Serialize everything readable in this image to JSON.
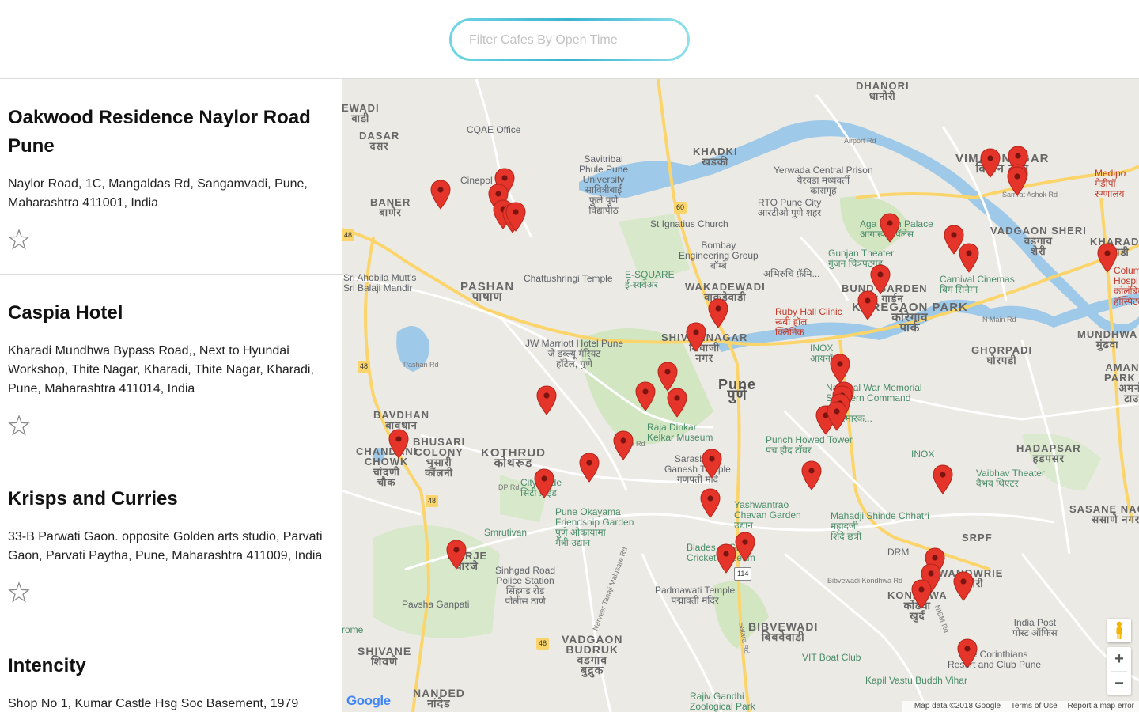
{
  "search": {
    "placeholder": "Filter Cafes By Open Time"
  },
  "cafes": [
    {
      "name": "Oakwood Residence Naylor Road Pune",
      "address": "Naylor Road, 1C, Mangaldas Rd, Sangamvadi, Pune, Maharashtra 411001, India"
    },
    {
      "name": "Caspia Hotel",
      "address": "Kharadi Mundhwa Bypass Road,, Next to Hyundai Workshop, Thite Nagar, Kharadi, Thite Nagar, Kharadi, Pune, Maharashtra 411014, India"
    },
    {
      "name": "Krisps and Curries",
      "address": "33-B Parwati Gaon. opposite Golden arts studio, Parvati Gaon, Parvati Paytha, Pune, Maharashtra 411009, India"
    },
    {
      "name": "Intencity",
      "address": "Shop No 1, Kumar Castle Hsg Soc Basement, 1979"
    }
  ],
  "map": {
    "labels": {
      "dhanori": "DHANORI",
      "dhanori_mr": "धानोरी",
      "ewadi": "EWADI",
      "ewadi_mr": "वाडी",
      "cqae": "CQAE Office",
      "dasar": "DASAR",
      "dasar_mr": "दसर",
      "khadki": "KHADKI",
      "khadki_mr": "खडकी",
      "savitribai": "Savitribai",
      "savitribai2": "Phule Pune",
      "savitribai3": "University",
      "savitribai_mr": "सावित्रीबाई",
      "savitribai_mr2": "फुले पुणे",
      "savitribai_mr3": "विद्यापीठ",
      "yerwada": "Yerwada Central Prison",
      "yerwada_mr": "येरवडा मध्यवर्ती",
      "yerwada_mr2": "कारागृह",
      "viman": "VIMAN NAGAR",
      "viman_mr": "विमान नगर",
      "medipoint": "Medipo",
      "medipoint_mr": "मेडीपॉ",
      "medipoint_mr2": "रुग्णालय",
      "airport_rd": "Airport Rd",
      "baner": "BANER",
      "baner_mr": "बाणेर",
      "cinepolis": "Cinepol",
      "rto": "RTO Pune City",
      "rto_mr": "आरटीओ पुणे शहर",
      "aga_khan": "Aga Khan Palace",
      "aga_khan_mr": "आगाखान पॅलेस",
      "vadgaon_sheri": "VADGAON SHERI",
      "vadgaon_sheri_mr": "वडगाव",
      "vadgaon_sheri_mr2": "शेरी",
      "samrat": "Samrat Ashok Rd",
      "st_ignatius": "St Ignatius Church",
      "bombay_eng": "Bombay",
      "bombay_eng2": "Engineering Group",
      "bombay_eng_mr": "बॉम्बे",
      "gunjan": "Gunjan Theater",
      "gunjan_mr": "गुंजन चित्रपटगृह",
      "kharadi": "KHARADI",
      "kharadi_mr": "खराडी",
      "columbia": "Colum",
      "columbia2": "Hospi",
      "columbia_mr": "कोलंबिय",
      "columbia_mr2": "हॉस्पिटल",
      "ahobila": "Sri Ahobila Mutt's",
      "ahobila2": "Sri Balaji Mandir",
      "pashan": "PASHAN",
      "pashan_mr": "पाषाण",
      "chattushringi": "Chattushringi Temple",
      "esquare": "E-SQUARE",
      "esquare_mr": "ई-स्क्वेअर",
      "abhiruchi": "अभिरुचि फ़ॅमि...",
      "wakadewadi": "WAKADEWADI",
      "wakadewadi_mr": "वाकडेवाडी",
      "bund_garden": "BUND GARDEN",
      "bund_garden_mr": "बंड गार्डन",
      "carnival": "Carnival Cinemas",
      "carnival_mr": "बिग सिनेमा",
      "koregaon": "KOREGAON PARK",
      "koregaon_mr": "कोरेगाव",
      "koregaon_mr2": "पार्क",
      "ruby": "Ruby Hall Clinic",
      "ruby_mr": "रूबी हॉल",
      "ruby_mr2": "क्लिनिक",
      "n_main": "N Main Rd",
      "mundhwa": "MUNDHWA",
      "mundhwa_mr": "मुंढवा",
      "amanora": "AMANORA",
      "amanora2": "PARK TOW",
      "amanora_mr": "अमनोरा",
      "amanora_mr2": "टाउन",
      "jw": "JW Marriott Hotel Pune",
      "jw_mr": "जे डब्ल्यू मॅरियट",
      "jw_mr2": "हॉटेल, पुणे",
      "shivajinagar": "SHIVAJINAGAR",
      "shivajinagar_mr": "शिवाजी",
      "shivajinagar_mr2": "नगर",
      "inox1": "INOX",
      "inox1_mr": "आयनॉक्स",
      "ghorpadi": "GHORPADI",
      "ghorpadi_mr": "घोरपडी",
      "pune": "Pune",
      "pune_mr": "पुणे",
      "national_war": "National War Memorial",
      "national_war2": "Southern Command",
      "national_war_mr": "राष्ट्रीय",
      "national_war_mr2": "युद्ध स्मारक...",
      "pashan_rd": "Pashan Rd",
      "bavdhan": "BAVDHAN",
      "bavdhan_mr": "बावधान",
      "bhusari": "BHUSARI",
      "bhusari2": "COLONY",
      "bhusari_mr": "भुसारी",
      "bhusari_mr2": "कॉलनी",
      "chandani": "CHANDANI",
      "chandani2": "CHOWK",
      "chandani_mr": "चांदणी",
      "chandani_mr2": "चौक",
      "kothrud": "KOTHRUD",
      "kothrud_mr": "कोथरूड",
      "raja": "Raja Dinkar",
      "raja2": "Kelkar Museum",
      "punch": "Punch Howed Tower",
      "punch_mr": "पंच हौद टॉवर",
      "inox2": "INOX",
      "hadapsar": "HADAPSAR",
      "hadapsar_mr": "हडपसर",
      "vaibhav": "Vaibhav Theater",
      "vaibhav_mr": "वैभव थिएटर",
      "cityride": "City Pride",
      "cityride_mr": "सिटी प्राईड",
      "dp_rd": "DP Rd",
      "sarasbaug": "Sarasbaug",
      "ganesh": "Ganesh Temple",
      "ganesh_mr": "गणपती मंदि",
      "karve": "Karve Rd",
      "pune_okayama": "Pune Okayama",
      "pune_okayama2": "Friendship Garden",
      "pune_okayama_mr": "पुणे ओकायामा",
      "pune_okayama_mr2": "मैत्री उद्यान",
      "yashwantrao": "Yashwantrao",
      "yashwantrao2": "Chavan Garden",
      "yashwantrao_mr": "उद्यान",
      "mahadji": "Mahadji Shinde Chhatri",
      "mahadji_mr": "महादजी",
      "mahadji_mr2": "शिंदे छत्री",
      "sasane": "SASANE NAGAR",
      "sasane_mr": "ससाणे नगर",
      "smrutivan": "Smrutivan",
      "warje": "WARJE",
      "warje_mr": "वारजे",
      "blades": "Blades of Glory",
      "blades2": "Cricket Museum",
      "srpf": "SRPF",
      "drm": "DRM",
      "wanowrie": "WANOWRIE",
      "wanowrie_mr": "वानोरी",
      "sinhgad": "Sinhgad Road",
      "sinhgad2": "Police Station",
      "sinhgad_mr": "सिंहगड रोड",
      "sinhgad_mr2": "पोलीस ठाणे",
      "padmawati": "Padmawati Temple",
      "padmawati_mr": "पद्मावती मंदिर",
      "bibvewadi": "BIBVEWADI",
      "bibvewadi_mr": "बिबवेवाडी",
      "kondhwa": "KONDHWA",
      "kondhwa_mr": "कोंढवा",
      "kondhwa_mr2": "खुर्द",
      "bibvewadi_rd": "Bibvewadi Kondhwa Rd",
      "pavsha": "Pavsha Ganpati",
      "india_post": "India Post",
      "india_post_mr": "पोस्ट ऑफिस",
      "corinthians": "The Corinthians",
      "corinthians2": "Resort and Club Pune",
      "vadgaon_budruk": "VADGAON",
      "vadgaon_budruk2": "BUDRUK",
      "vadgaon_budruk_mr": "वडगाव",
      "vadgaon_budruk_mr2": "बुद्रुक",
      "shivane": "SHIVANE",
      "shivane_mr": "शिवणे",
      "vit": "VIT Boat Club",
      "kapil": "Kapil Vastu Buddh Vihar",
      "nanded": "NANDED",
      "nanded_mr": "नांदेड",
      "rajiv": "Rajiv Gandhi",
      "rajiv2": "Zoological Park",
      "satara": "Satara Rd",
      "nbm": "NIBM Rd",
      "rome": "rome",
      "narveer": "Narveer Tanaji Malusare Rd",
      "r60": "60",
      "r48a": "48",
      "r48b": "48",
      "r48c": "48",
      "r48d": "48",
      "r114": "114"
    },
    "zoom_in": "+",
    "zoom_out": "−",
    "attribution": "Map data ©2018 Google",
    "terms": "Terms of Use",
    "report": "Report a map error",
    "logo": "Google",
    "colors": {
      "pin": "#e5352a",
      "pin_dot": "#7a1410",
      "water": "#9fc9e8",
      "park": "#c6e2b4",
      "highway": "#fbd56b",
      "road": "#ffffff"
    }
  }
}
